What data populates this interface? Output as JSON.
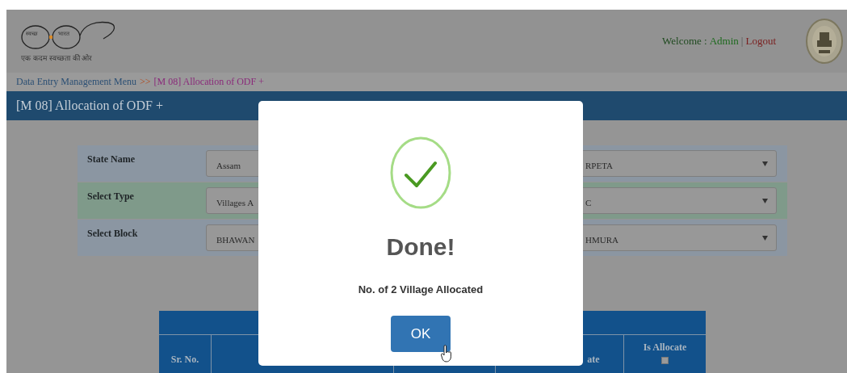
{
  "header": {
    "logo": {
      "lens_left": "स्वच्छ",
      "lens_right": "भारत",
      "tagline": "एक कदम स्वच्छता की ओर"
    },
    "welcome_label": "Welcome :",
    "user": "Admin",
    "separator": "|",
    "logout": "Logout"
  },
  "breadcrumb": {
    "parent": "Data Entry Management Menu",
    "separator": ">>",
    "current": "[M 08] Allocation of ODF +"
  },
  "page_title": "[M 08] Allocation of ODF +",
  "form": {
    "rows": [
      {
        "label": "State Name",
        "left_value": "Assam",
        "right_value": "RPETA",
        "highlighted": false
      },
      {
        "label": "Select Type",
        "left_value": "Villages A",
        "right_value": "C",
        "highlighted": true
      },
      {
        "label": "Select Block",
        "left_value": "BHAWAN",
        "right_value": "HMURA",
        "highlighted": false
      }
    ]
  },
  "table": {
    "columns": [
      {
        "label": "Sr. No."
      },
      {
        "label": "ate"
      },
      {
        "label": "Is Allocate",
        "checkbox": {
          "checked": false
        }
      }
    ]
  },
  "dialog": {
    "title": "Done!",
    "message": "No. of 2 Village Allocated",
    "button": "OK"
  }
}
